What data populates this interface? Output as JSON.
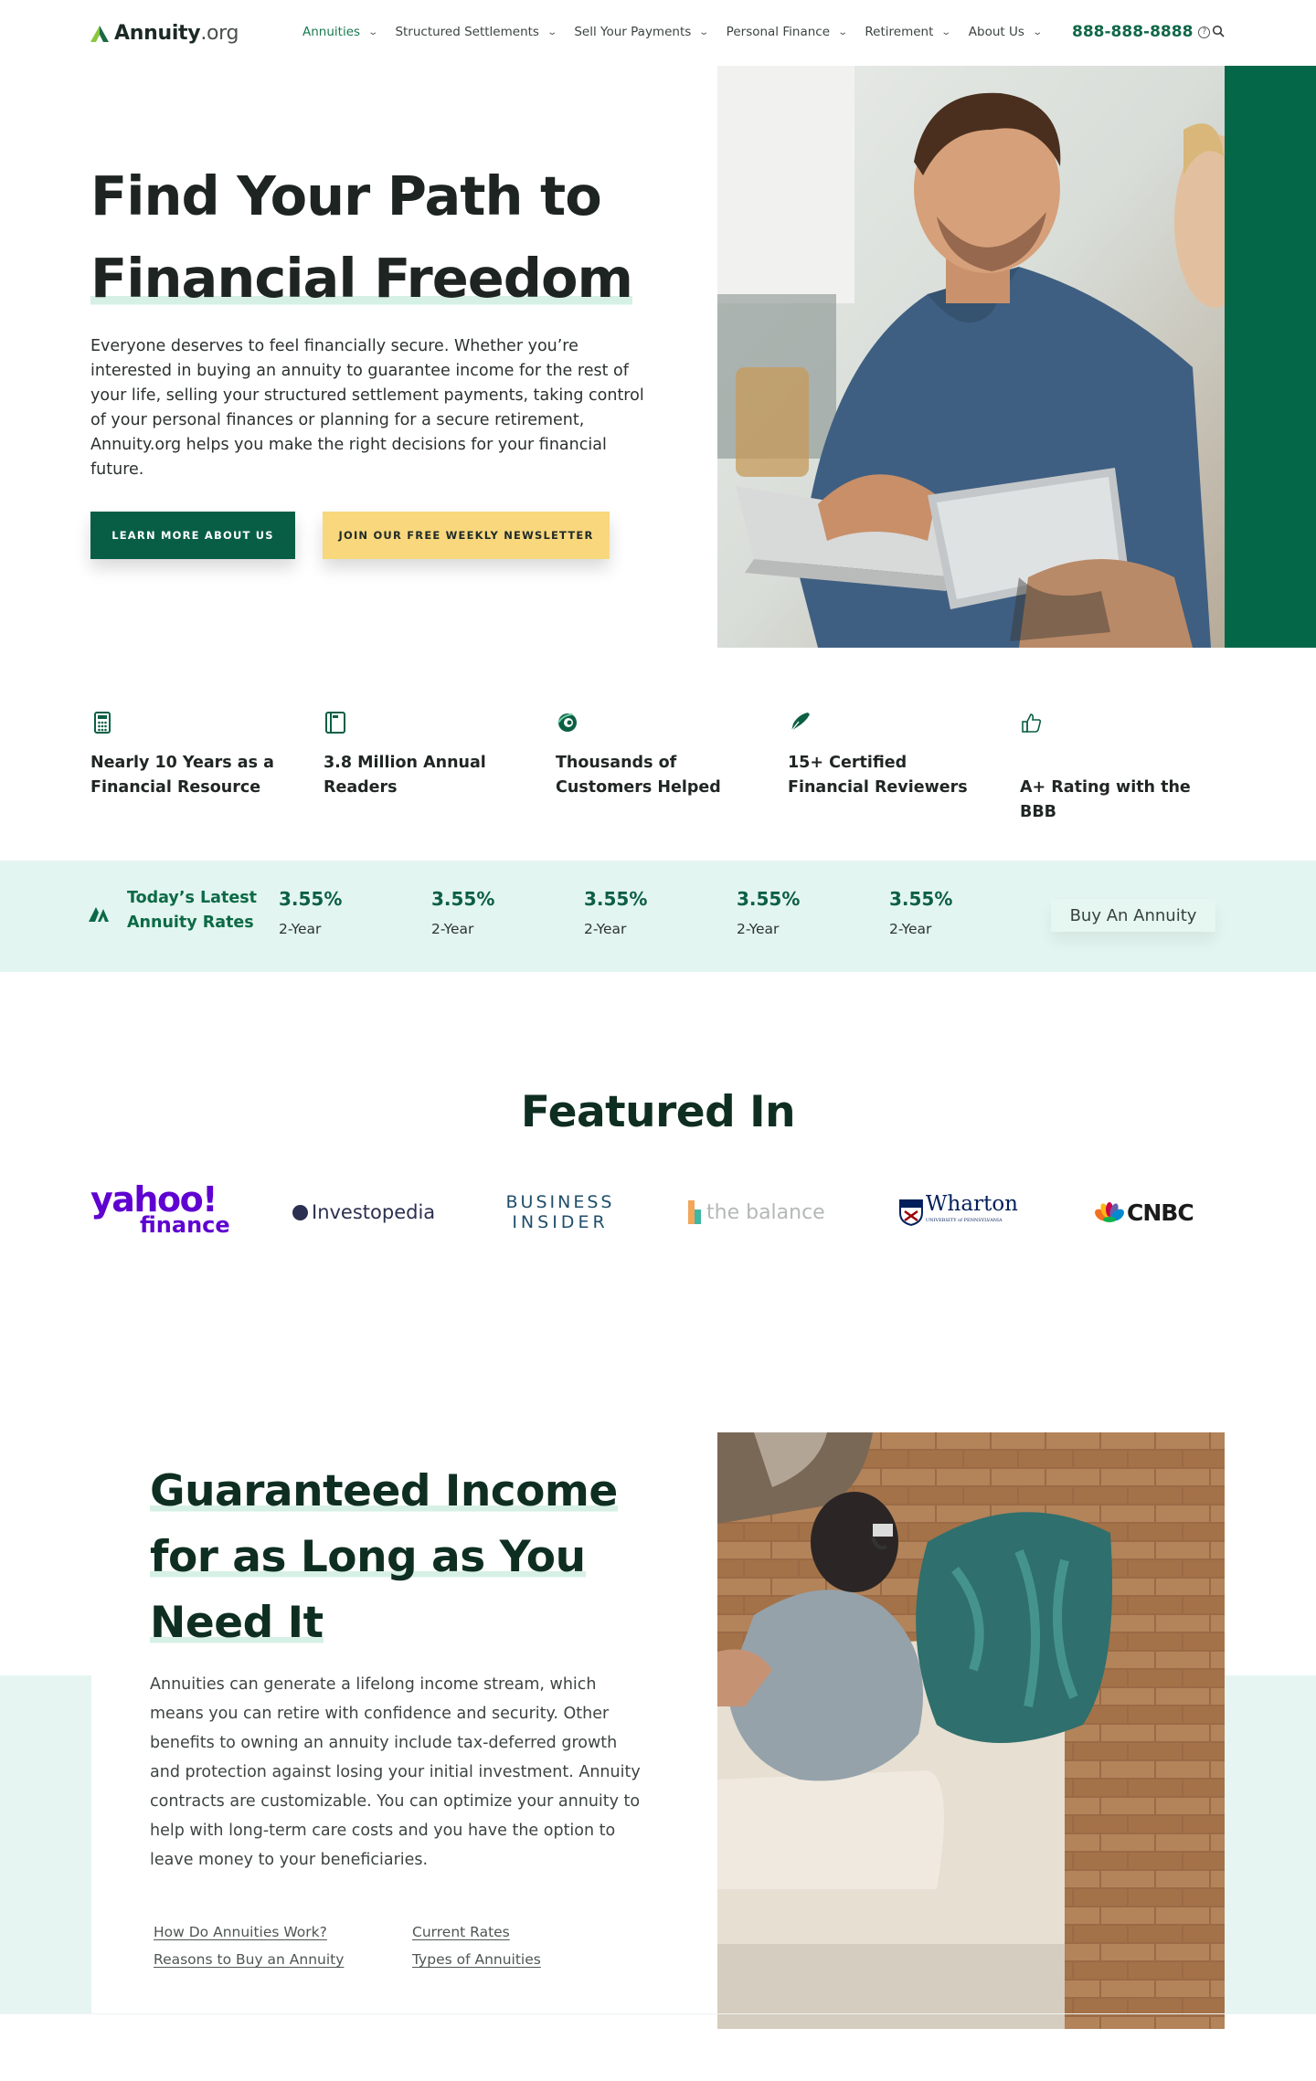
{
  "brand": {
    "name": "Annuity",
    "tld": ".org"
  },
  "nav": {
    "items": [
      {
        "label": "Annuities",
        "active": true
      },
      {
        "label": "Structured Settlements"
      },
      {
        "label": "Sell Your Payments"
      },
      {
        "label": "Personal Finance"
      },
      {
        "label": "Retirement"
      },
      {
        "label": "About Us"
      }
    ],
    "phone": "888-888-8888",
    "help_glyph": "?"
  },
  "hero": {
    "title_line1": "Find Your Path to",
    "title_line2": "Financial Freedom",
    "text": "Everyone deserves to feel financially secure. Whether you’re interested in buying an annuity to guarantee income for the rest of your life, selling your structured settlement payments, taking control of your personal finances or planning for a secure retirement, Annuity.org helps you make the right decisions for your financial future.",
    "primary_button": "LEARN MORE ABOUT US",
    "secondary_button": "JOIN OUR FREE WEEKLY NEWSLETTER"
  },
  "stats": [
    {
      "icon": "calculator-icon",
      "label": "Nearly 10 Years as a Financial Resource"
    },
    {
      "icon": "book-icon",
      "label": "3.8 Million Annual Readers"
    },
    {
      "icon": "hands-icon",
      "label": "Thousands of Customers Helped"
    },
    {
      "icon": "pen-icon",
      "label": "15+ Certified Financial Reviewers"
    },
    {
      "icon": "thumbs-up-icon",
      "label": "A+ Rating with the BBB"
    }
  ],
  "rates": {
    "title": "Today’s Latest Annuity Rates",
    "items": [
      {
        "rate": "3.55%",
        "term": "2-Year"
      },
      {
        "rate": "3.55%",
        "term": "2-Year"
      },
      {
        "rate": "3.55%",
        "term": "2-Year"
      },
      {
        "rate": "3.55%",
        "term": "2-Year"
      },
      {
        "rate": "3.55%",
        "term": "2-Year"
      }
    ],
    "button": "Buy An Annuity"
  },
  "featured": {
    "title": "Featured In",
    "logos": {
      "yahoo_top": "yahoo!",
      "yahoo_bottom": "finance",
      "investopedia": "Investopedia",
      "bi_top": "BUSINESS",
      "bi_bottom": "INSIDER",
      "balance": "the balance",
      "wharton": "Wharton",
      "wharton_sub": "UNIVERSITY of PENNSYLVANIA",
      "cnbc": "CNBC"
    }
  },
  "section2": {
    "title_line1": "Guaranteed Income",
    "title_line2": "for as Long as You",
    "title_line3": "Need It",
    "text": "Annuities can generate a lifelong income stream, which means you can retire with confidence and security. Other benefits to owning an annuity include tax-deferred growth and protection against losing your initial investment. Annuity contracts are customizable. You can optimize your annuity to help with long-term care costs and you have the option to leave money to your beneficiaries.",
    "links": [
      "How Do Annuities Work?",
      "Reasons to Buy an Annuity",
      "Current Rates",
      "Types of Annuities"
    ]
  },
  "colors": {
    "brand_green": "#046848",
    "accent_yellow": "#f8d77d",
    "mint": "#e3f5f0"
  }
}
